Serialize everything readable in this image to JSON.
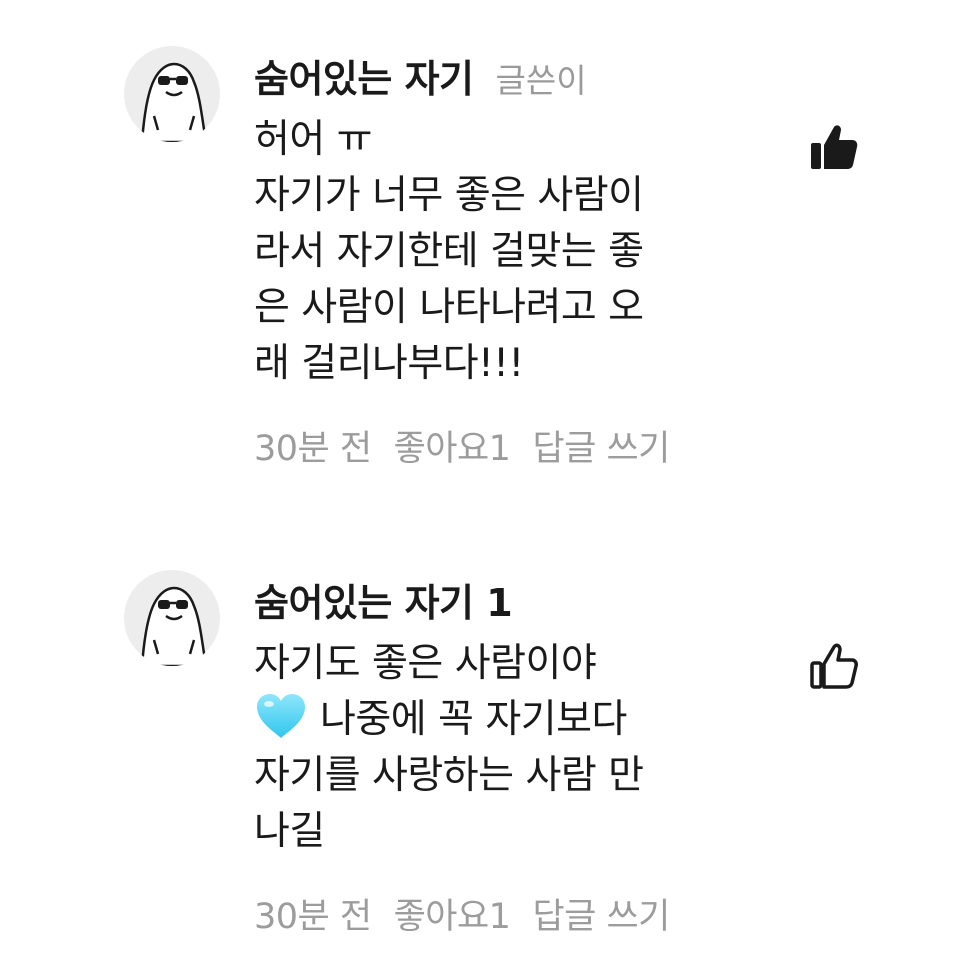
{
  "comments": [
    {
      "author": "숨어있는 자기",
      "badge": "글쓴이",
      "lines": [
        "허어 ㅠ",
        "자기가 너무 좋은 사람이",
        "라서 자기한테 걸맞는 좋",
        "은 사람이 나타나려고 오",
        "래 걸리나부다!!!"
      ],
      "time": "30분 전",
      "likes_label": "좋아요1",
      "reply_label": "답글 쓰기",
      "liked": true,
      "avatar_icon": "sunglasses-character-icon",
      "like_icon": "thumbs-up-filled-icon"
    },
    {
      "author": "숨어있는 자기 1",
      "badge": "",
      "lines": [
        "자기도 좋은 사람이야",
        "나중에 꼭 자기보다",
        "자기를 사랑하는 사람 만",
        "나길"
      ],
      "emoji": "light-blue-heart-icon",
      "time": "30분 전",
      "likes_label": "좋아요1",
      "reply_label": "답글 쓰기",
      "liked": false,
      "avatar_icon": "sunglasses-character-icon",
      "like_icon": "thumbs-up-outline-icon"
    }
  ],
  "colors": {
    "text": "#1a1a1a",
    "muted": "#9c9c9c",
    "avatar_bg": "#ededed",
    "heart": "#5fd4f4"
  }
}
